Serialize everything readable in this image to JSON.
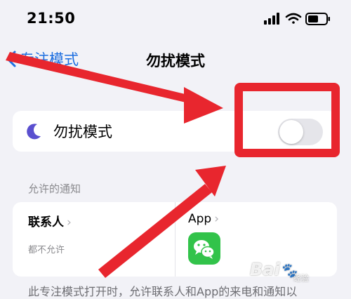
{
  "status_bar": {
    "time": "21:50",
    "icons": [
      "cellular-signal-icon",
      "wifi-icon",
      "battery-icon"
    ]
  },
  "nav": {
    "back_label": "专注模式",
    "title": "勿扰模式"
  },
  "dnd_row": {
    "icon": "moon-icon",
    "label": "勿扰模式",
    "toggle_on": false
  },
  "allowed_notifications": {
    "header": "允许的通知",
    "people": {
      "title": "联系人",
      "subtitle": "都不允许"
    },
    "apps": {
      "title": "App",
      "icon": "wechat-app-icon"
    }
  },
  "footer": {
    "text": "此专注模式打开时，允许联系人和App的来电和通知以"
  },
  "watermark": {
    "logo": "Bai",
    "sub": "经验"
  },
  "colors": {
    "accent": "#1e6fe0",
    "moon": "#5a4fcf",
    "annotation_red": "#e8262e",
    "wechat_green": "#32c34a"
  }
}
